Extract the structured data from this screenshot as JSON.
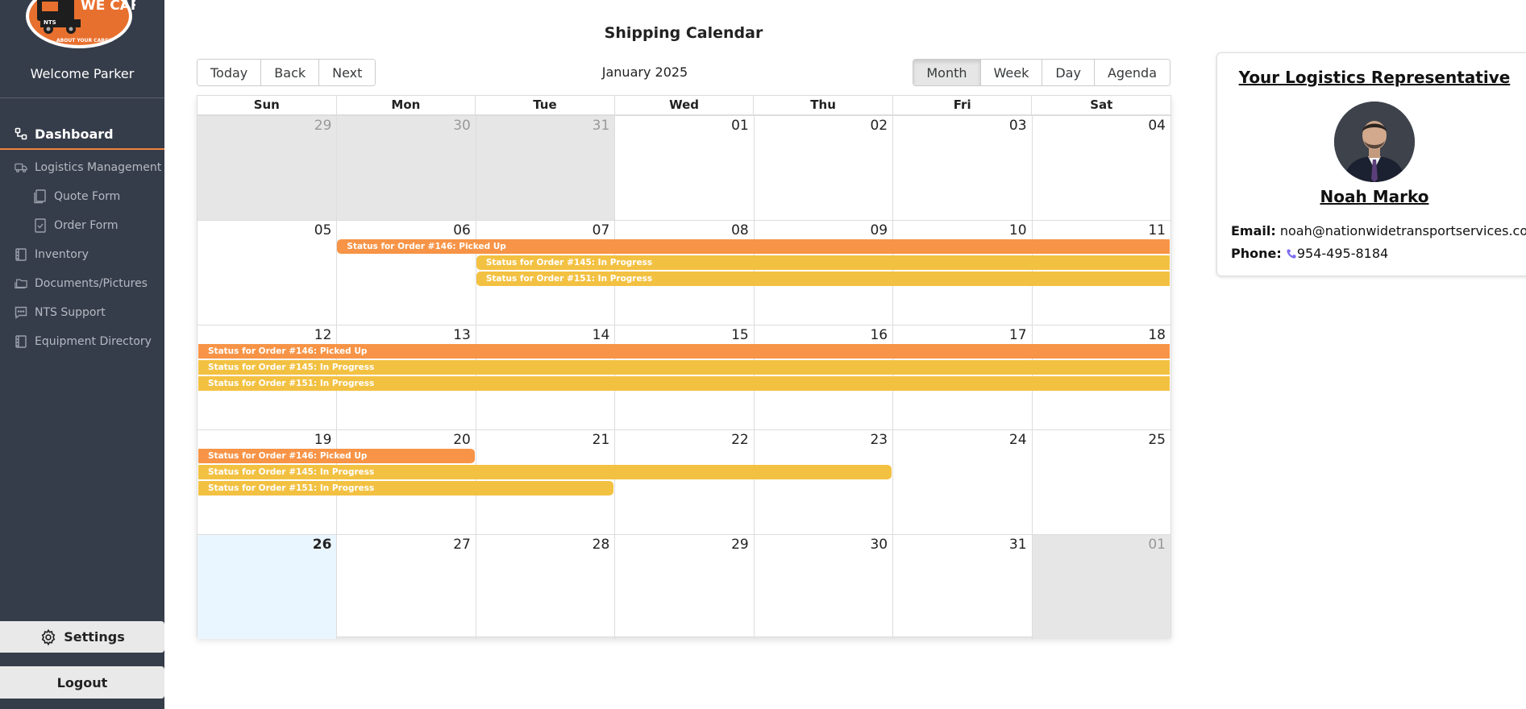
{
  "sidebar": {
    "logo_text": "WE CARE",
    "logo_sub": "ABOUT YOUR CARGO",
    "logo_badge": "NTS",
    "welcome": "Welcome Parker",
    "items": [
      {
        "label": "Dashboard",
        "icon": "dashboard-icon",
        "active": true
      },
      {
        "label": "Logistics Management",
        "icon": "truck-icon"
      },
      {
        "label": "Quote Form",
        "icon": "document-icon",
        "sub": true
      },
      {
        "label": "Order Form",
        "icon": "checked-document-icon",
        "sub": true
      },
      {
        "label": "Inventory",
        "icon": "list-icon"
      },
      {
        "label": "Documents/Pictures",
        "icon": "folder-icon"
      },
      {
        "label": "NTS Support",
        "icon": "chat-icon"
      },
      {
        "label": "Equipment Directory",
        "icon": "directory-icon"
      }
    ],
    "settings_label": "Settings",
    "logout_label": "Logout"
  },
  "calendar": {
    "title": "Shipping Calendar",
    "nav": {
      "today": "Today",
      "back": "Back",
      "next": "Next"
    },
    "label": "January 2025",
    "views": [
      "Month",
      "Week",
      "Day",
      "Agenda"
    ],
    "active_view": "Month",
    "weekdays": [
      "Sun",
      "Mon",
      "Tue",
      "Wed",
      "Thu",
      "Fri",
      "Sat"
    ],
    "weeks": [
      [
        {
          "d": "29",
          "off": true
        },
        {
          "d": "30",
          "off": true
        },
        {
          "d": "31",
          "off": true
        },
        {
          "d": "01"
        },
        {
          "d": "02"
        },
        {
          "d": "03"
        },
        {
          "d": "04"
        }
      ],
      [
        {
          "d": "05"
        },
        {
          "d": "06"
        },
        {
          "d": "07"
        },
        {
          "d": "08"
        },
        {
          "d": "09"
        },
        {
          "d": "10"
        },
        {
          "d": "11"
        }
      ],
      [
        {
          "d": "12"
        },
        {
          "d": "13"
        },
        {
          "d": "14"
        },
        {
          "d": "15"
        },
        {
          "d": "16"
        },
        {
          "d": "17"
        },
        {
          "d": "18"
        }
      ],
      [
        {
          "d": "19"
        },
        {
          "d": "20"
        },
        {
          "d": "21"
        },
        {
          "d": "22"
        },
        {
          "d": "23"
        },
        {
          "d": "24"
        },
        {
          "d": "25"
        }
      ],
      [
        {
          "d": "26",
          "today": true
        },
        {
          "d": "27"
        },
        {
          "d": "28"
        },
        {
          "d": "29"
        },
        {
          "d": "30"
        },
        {
          "d": "31"
        },
        {
          "d": "01",
          "off": true
        }
      ]
    ],
    "event_colors": {
      "picked_up": "#f79447",
      "in_progress": "#f3c142"
    },
    "events": [
      {
        "label": "Status for Order #146: Picked Up",
        "kind": "picked_up",
        "start": "2025-01-06",
        "end": "2025-01-20"
      },
      {
        "label": "Status for Order #145: In Progress",
        "kind": "in_progress",
        "start": "2025-01-07",
        "end": "2025-01-23"
      },
      {
        "label": "Status for Order #151: In Progress",
        "kind": "in_progress",
        "start": "2025-01-07",
        "end": "2025-01-21"
      }
    ]
  },
  "rep": {
    "title": "Your Logistics Representative",
    "name": "Noah Marko",
    "email_label": "Email:",
    "email": "noah@nationwidetransportservices.com",
    "phone_label": "Phone:",
    "phone": "954-495-8184"
  }
}
